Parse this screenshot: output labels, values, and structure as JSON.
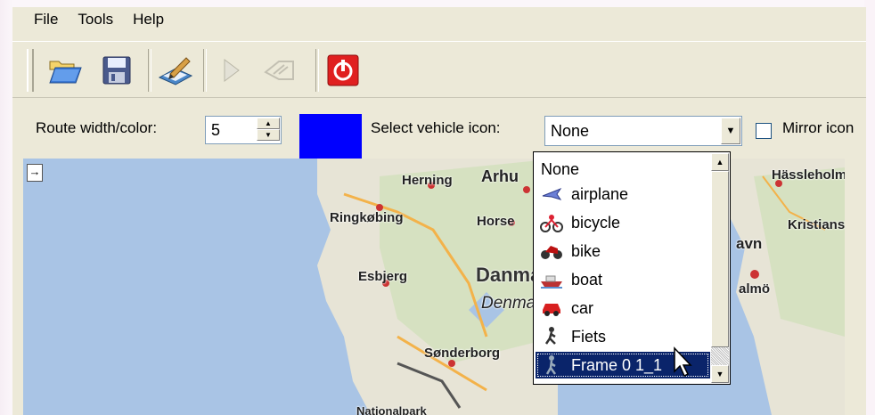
{
  "menu": {
    "items": [
      "File",
      "Tools",
      "Help"
    ]
  },
  "toolbar": {
    "buttons": [
      "open-icon",
      "save-icon",
      "edit-icon",
      "play-icon",
      "step-icon",
      "power-icon"
    ]
  },
  "options": {
    "route_label": "Route width/color:",
    "route_width": "5",
    "route_color": "#0000ff",
    "vehicle_label": "Select vehicle icon:",
    "vehicle_selected": "None",
    "mirror_label": "Mirror icon"
  },
  "dropdown": {
    "items": [
      {
        "label": "None",
        "icon": ""
      },
      {
        "label": "airplane",
        "icon": "airplane-icon"
      },
      {
        "label": "bicycle",
        "icon": "bicycle-icon"
      },
      {
        "label": "bike",
        "icon": "bike-icon"
      },
      {
        "label": "boat",
        "icon": "boat-icon"
      },
      {
        "label": "car",
        "icon": "car-icon"
      },
      {
        "label": "Fiets",
        "icon": "fiets-icon"
      },
      {
        "label": "Frame 0 1_1",
        "icon": "walker-icon"
      }
    ],
    "highlighted": "Frame 0 1_1"
  },
  "map": {
    "labels": {
      "herning": "Herning",
      "arhus": "Arhu",
      "ringkobing": "Ringkøbing",
      "horsens": "Horse",
      "esbjerg": "Esbjerg",
      "denmark": "Danma",
      "denmark_italic": "Denma",
      "sonderborg": "Sønderborg",
      "national": "Nationalpark",
      "hassleholm": "Hässleholm",
      "kristianstad": "Kristiansta",
      "havn": "avn",
      "malmo": "almö"
    }
  }
}
